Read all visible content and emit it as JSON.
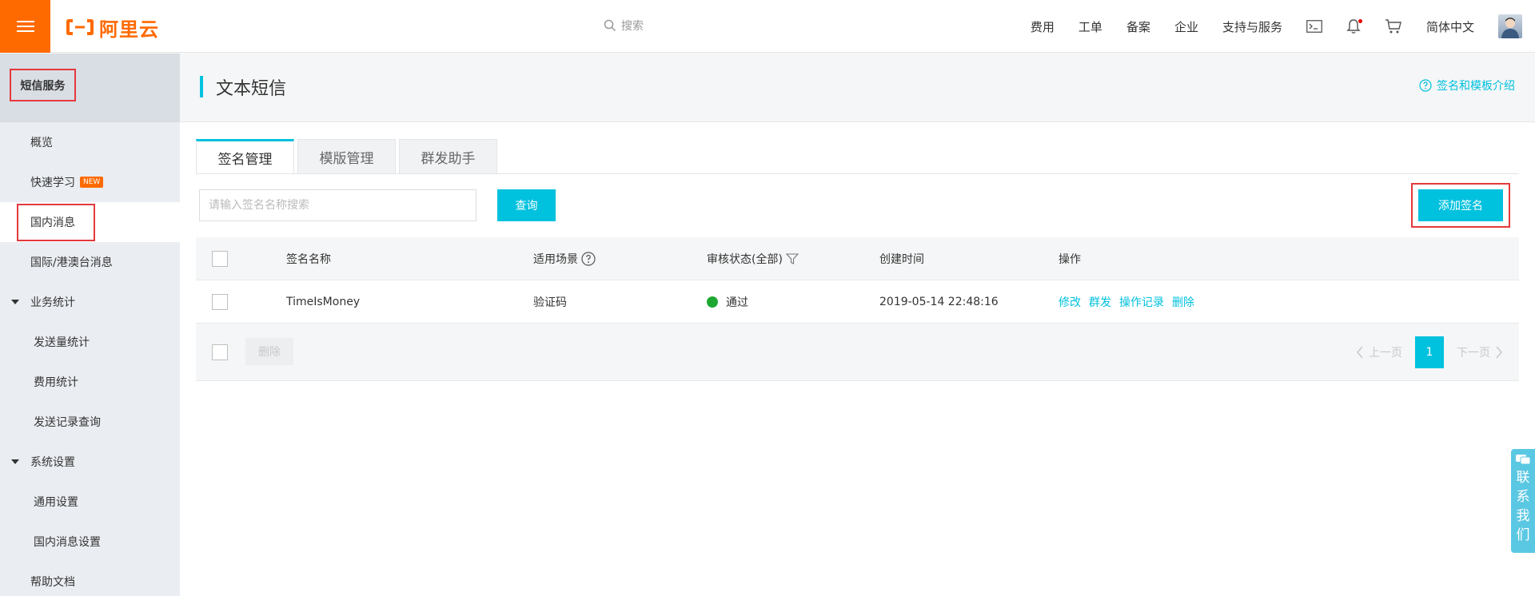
{
  "topbar": {
    "logo_text": "阿里云",
    "search_placeholder": "搜索",
    "nav": [
      "费用",
      "工单",
      "备案",
      "企业",
      "支持与服务"
    ],
    "language": "简体中文",
    "brand_color": "#ff6a00"
  },
  "sidebar": {
    "title": "短信服务",
    "items": [
      {
        "label": "概览"
      },
      {
        "label": "快速学习",
        "badge": "NEW"
      },
      {
        "label": "国内消息"
      },
      {
        "label": "国际/港澳台消息"
      },
      {
        "label": "业务统计"
      },
      {
        "label": "发送量统计"
      },
      {
        "label": "费用统计"
      },
      {
        "label": "发送记录查询"
      },
      {
        "label": "系统设置"
      },
      {
        "label": "通用设置"
      },
      {
        "label": "国内消息设置"
      },
      {
        "label": "帮助文档"
      }
    ]
  },
  "page": {
    "title": "文本短信",
    "help_link": "签名和模板介绍",
    "accent_color": "#00c1de"
  },
  "tabs": [
    {
      "label": "签名管理",
      "active": true
    },
    {
      "label": "模版管理",
      "active": false
    },
    {
      "label": "群发助手",
      "active": false
    }
  ],
  "toolbar": {
    "search_placeholder": "请输入签名名称搜索",
    "query_label": "查询",
    "add_label": "添加签名"
  },
  "table": {
    "columns": [
      "签名名称",
      "适用场景",
      "审核状态(全部)",
      "创建时间",
      "操作"
    ],
    "rows": [
      {
        "name": "TimeIsMoney",
        "scene": "验证码",
        "status": "通过",
        "status_color": "#1ea832",
        "created": "2019-05-14 22:48:16",
        "actions": [
          "修改",
          "群发",
          "操作记录",
          "删除"
        ]
      }
    ]
  },
  "footer": {
    "delete_label": "删除",
    "prev_label": "上一页",
    "next_label": "下一页",
    "current_page": "1"
  },
  "contact": {
    "label": "联系我们"
  }
}
